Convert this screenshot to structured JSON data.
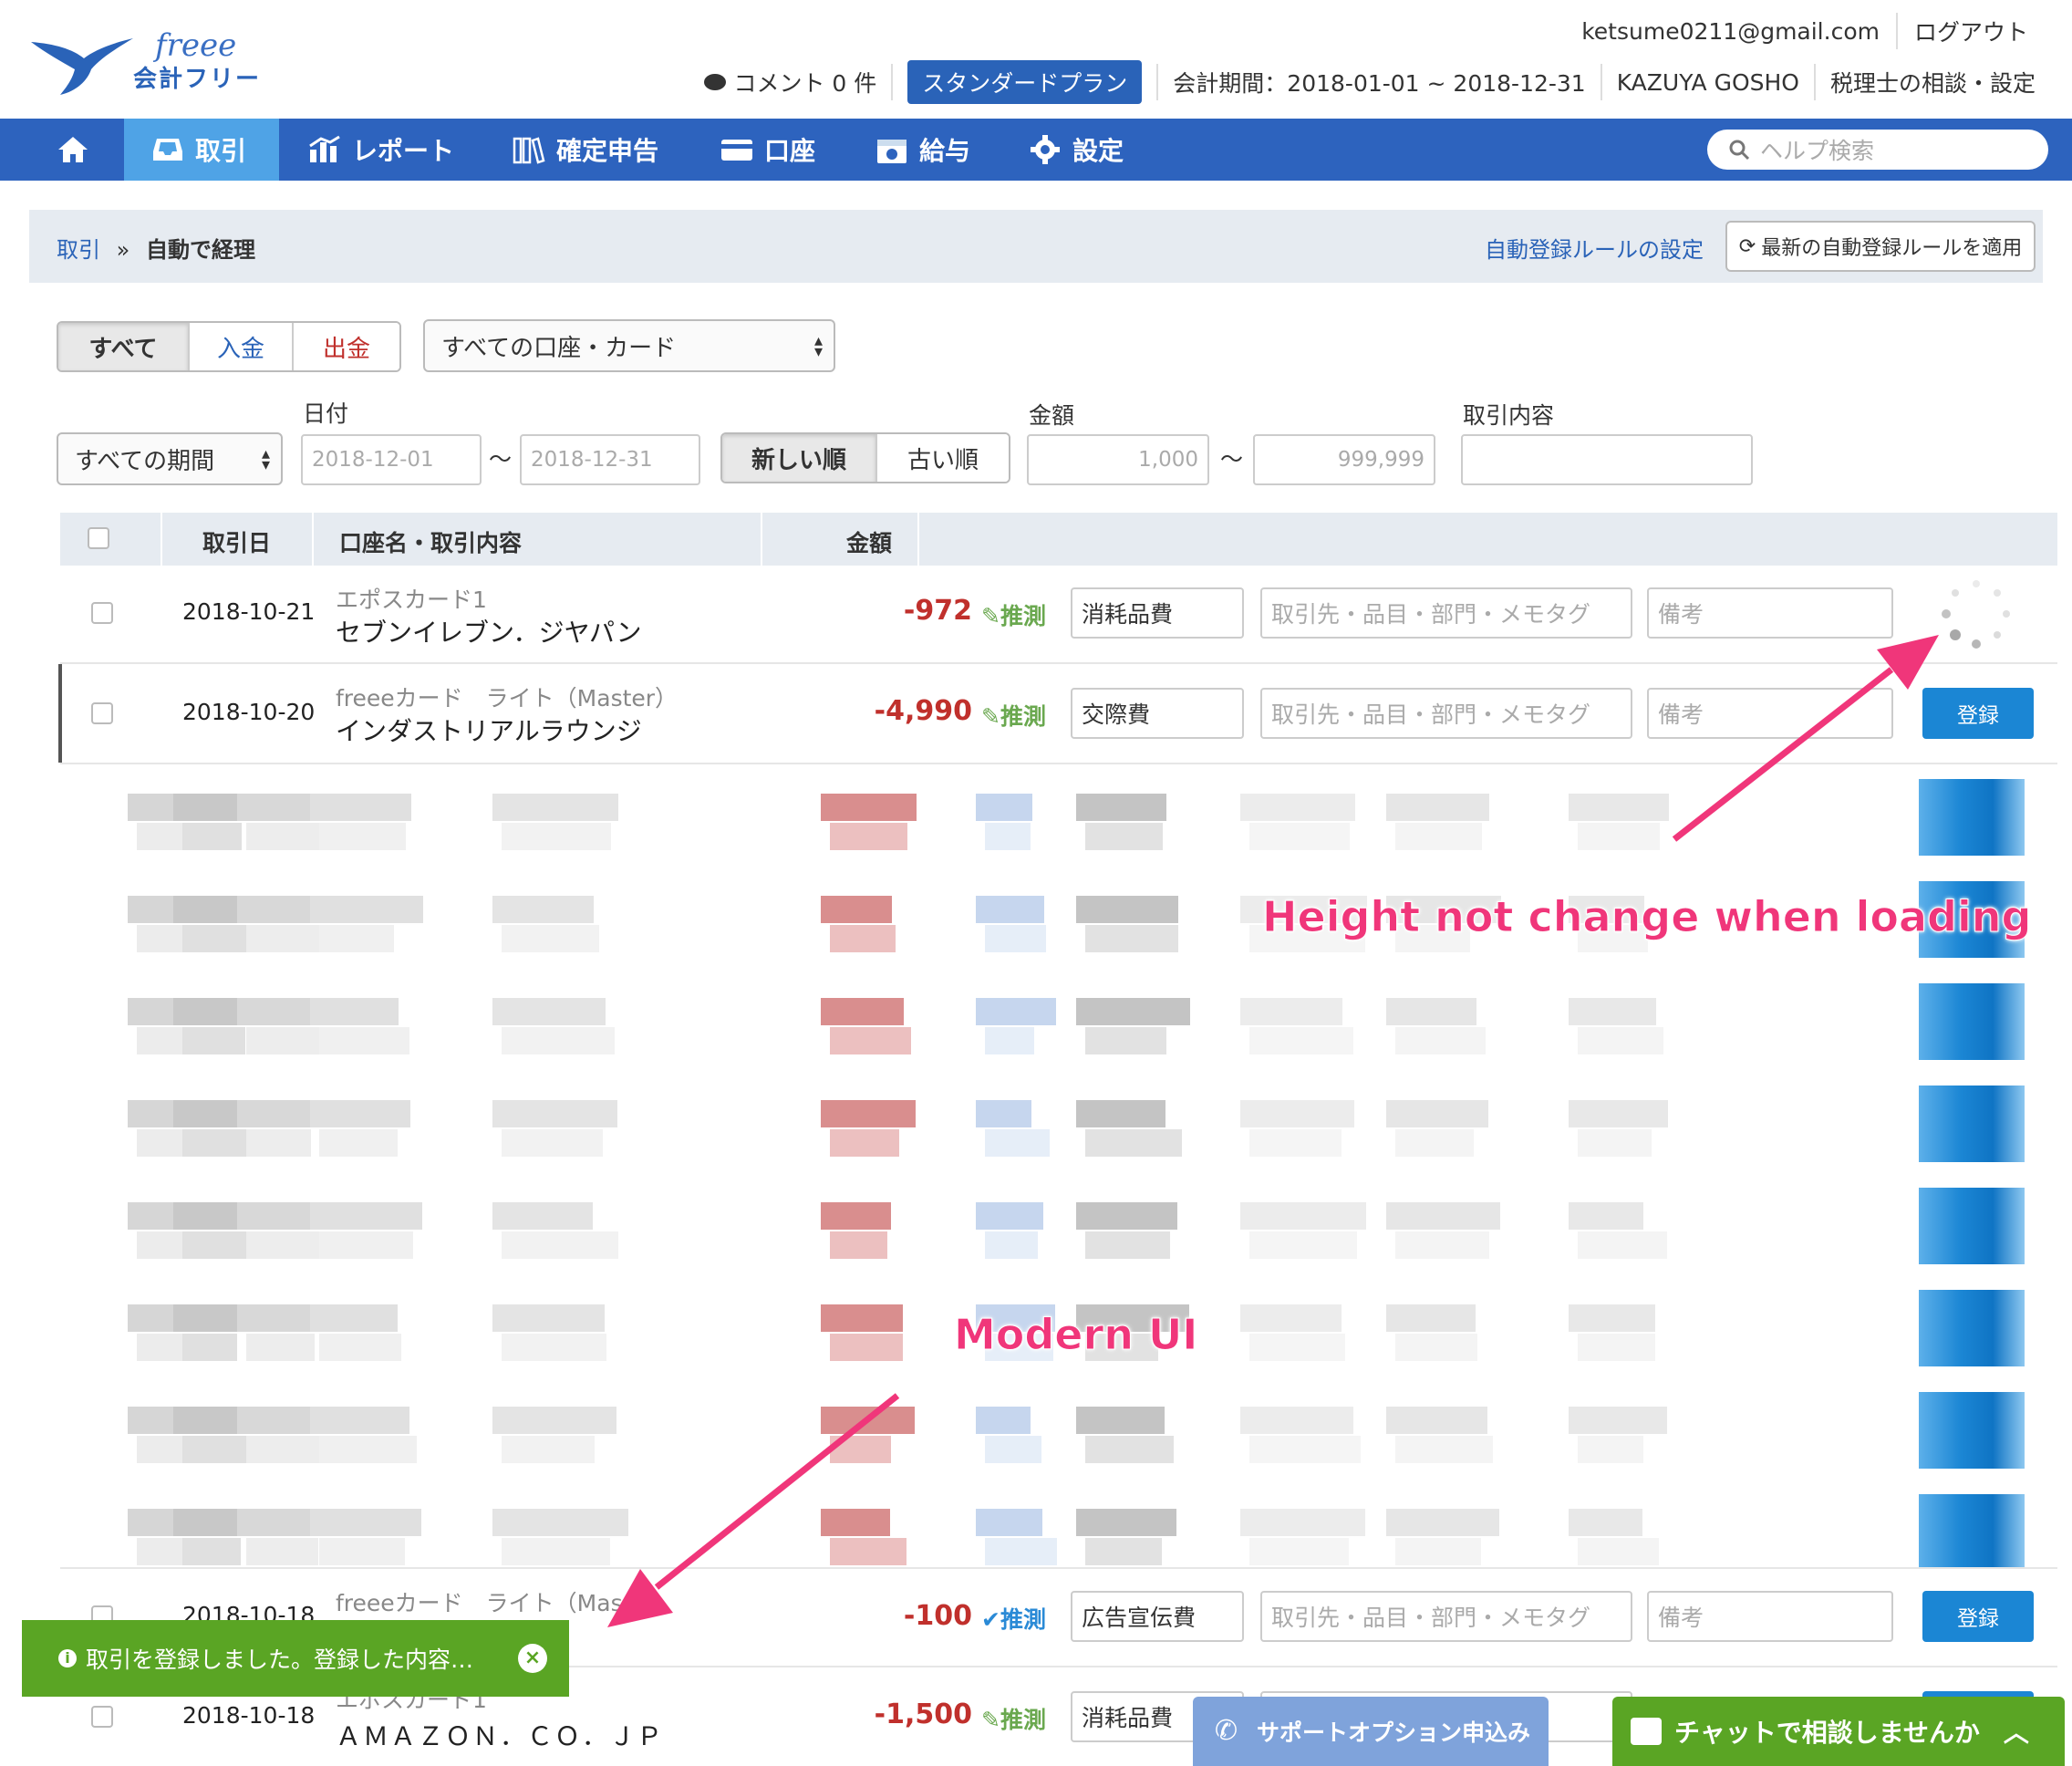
{
  "header": {
    "logo_text": "freee",
    "logo_sub": "会計フリー",
    "email": "ketsume0211@gmail.com",
    "logout": "ログアウト",
    "comment": "コメント 0 件",
    "plan": "スタンダードプラン",
    "period": "会計期間：2018-01-01 ~ 2018-12-31",
    "user": "KAZUYA GOSHO",
    "consult": "税理士の相談・設定"
  },
  "nav": {
    "items": [
      {
        "label": "",
        "icon": "home-icon"
      },
      {
        "label": "取引",
        "icon": "inbox-icon"
      },
      {
        "label": "レポート",
        "icon": "chart-icon"
      },
      {
        "label": "確定申告",
        "icon": "books-icon"
      },
      {
        "label": "口座",
        "icon": "card-icon"
      },
      {
        "label": "給与",
        "icon": "calendar-icon"
      },
      {
        "label": "設定",
        "icon": "gear-icon"
      }
    ],
    "search_placeholder": "ヘルプ検索"
  },
  "breadcrumb": {
    "parent": "取引",
    "sep": "»",
    "current": "自動で経理",
    "rule_link": "自動登録ルールの設定",
    "apply_button": "最新の自動登録ルールを適用"
  },
  "filters": {
    "type_tabs": [
      "すべて",
      "入金",
      "出金"
    ],
    "account_select": "すべての口座・カード",
    "period_select": "すべての期間",
    "date_label": "日付",
    "date_from": "2018-12-01",
    "date_to": "2018-12-31",
    "tilde": "〜",
    "sort_tabs": [
      "新しい順",
      "古い順"
    ],
    "amount_label": "金額",
    "amount_from": "1,000",
    "amount_to": "999,999",
    "content_label": "取引内容"
  },
  "table": {
    "headers": [
      "取引日",
      "口座名・取引内容",
      "金額"
    ],
    "guess_label": "推測",
    "partner_placeholder": "取引先・品目・部門・メモタグ",
    "note_placeholder": "備考",
    "register_label": "登録",
    "rows": [
      {
        "date": "2018-10-21",
        "account": "エポスカード1",
        "desc": "セブンイレブン．ジヤパン",
        "amount": "-972",
        "category": "消耗品費"
      },
      {
        "date": "2018-10-20",
        "account": "freeeカード　ライト（Master）",
        "desc": "インダストリアルラウンジ",
        "amount": "-4,990",
        "category": "交際費"
      },
      {
        "date": "2018-10-18",
        "account": "freeeカード　ライト（Mas",
        "desc": "",
        "amount": "-100",
        "category": "広告宣伝費"
      },
      {
        "date": "2018-10-18",
        "account": "エポスカード1",
        "desc": "ＡＭＡＺＯＮ．ＣＯ．ＪＰ",
        "amount": "-1,500",
        "category": "消耗品費"
      }
    ]
  },
  "annotations": {
    "loading": "Height not change when loading",
    "modern": "Modern UI"
  },
  "toast": {
    "message": "取引を登録しました。登録した内容…"
  },
  "support_button": "サポートオプション申込み",
  "chat_button": "チャットで相談しませんか"
}
